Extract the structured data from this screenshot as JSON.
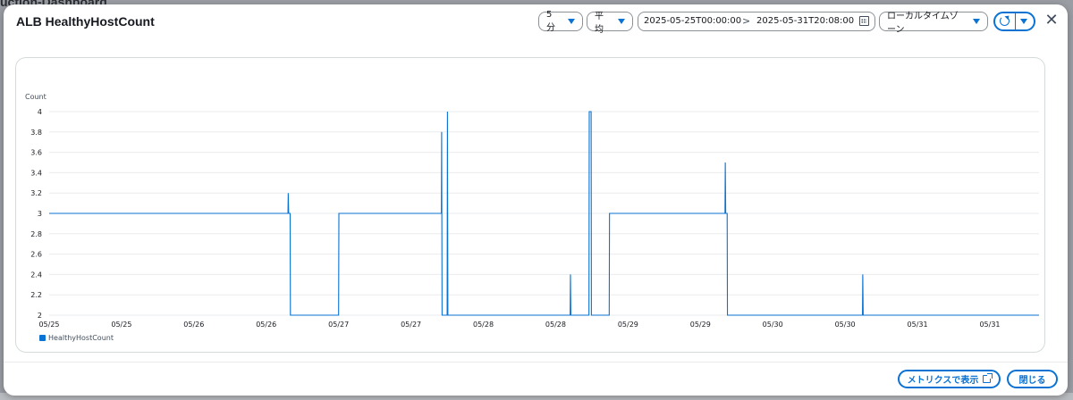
{
  "background": {
    "page_title_fragment": "uction-Dashboard"
  },
  "modal": {
    "title": "ALB HealthyHostCount",
    "controls": {
      "period": "5 分",
      "statistic": "平均",
      "date_start": "2025-05-25T00:00:00",
      "date_separator": ">",
      "date_end": "2025-05-31T20:08:00",
      "timezone": "ローカルタイムゾーン",
      "close_glyph": "✕"
    },
    "footer": {
      "view_in_metrics_label": "メトリクスで表示",
      "close_label": "閉じる"
    }
  },
  "chart_data": {
    "type": "line",
    "ylabel": "Count",
    "ylim": [
      2,
      4
    ],
    "y_ticks": [
      2,
      2.2,
      2.4,
      2.6,
      2.8,
      3,
      3.2,
      3.4,
      3.6,
      3.8,
      4
    ],
    "x_tick_labels": [
      "05/25",
      "05/25",
      "05/26",
      "05/26",
      "05/27",
      "05/27",
      "05/28",
      "05/28",
      "05/29",
      "05/29",
      "05/30",
      "05/30",
      "05/31",
      "05/31"
    ],
    "x_range_days": [
      0,
      6.84
    ],
    "grid": true,
    "legend": "bottom-left",
    "colors": {
      "series": "#0972d3",
      "grid": "#e9ebed",
      "axis_text": "#414d5c"
    },
    "series": [
      {
        "name": "HealthyHostCount",
        "points": [
          [
            0,
            3
          ],
          [
            1.65,
            3
          ],
          [
            1.652,
            3.2
          ],
          [
            1.655,
            3
          ],
          [
            1.665,
            3
          ],
          [
            1.667,
            2
          ],
          [
            2.0,
            2
          ],
          [
            2.002,
            3
          ],
          [
            2.71,
            3
          ],
          [
            2.712,
            3.8
          ],
          [
            2.715,
            2
          ],
          [
            2.75,
            2
          ],
          [
            2.752,
            4
          ],
          [
            2.755,
            2
          ],
          [
            3.6,
            2
          ],
          [
            3.602,
            2.4
          ],
          [
            3.605,
            2
          ],
          [
            3.73,
            2
          ],
          [
            3.732,
            4
          ],
          [
            3.745,
            4
          ],
          [
            3.747,
            2
          ],
          [
            3.87,
            2
          ],
          [
            3.872,
            3
          ],
          [
            4.67,
            3
          ],
          [
            4.672,
            3.5
          ],
          [
            4.675,
            3
          ],
          [
            4.685,
            3
          ],
          [
            4.687,
            2
          ],
          [
            5.62,
            2
          ],
          [
            5.622,
            2.4
          ],
          [
            5.625,
            2
          ],
          [
            6.84,
            2
          ]
        ]
      }
    ]
  }
}
